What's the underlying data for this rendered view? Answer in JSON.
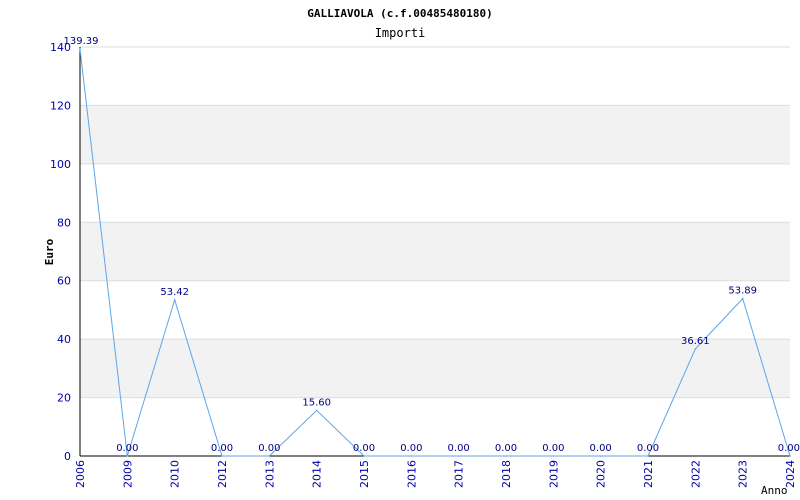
{
  "chart_data": {
    "type": "line",
    "title": "GALLIAVOLA (c.f.00485480180)",
    "subtitle": "Importi",
    "xlabel": "Anno",
    "ylabel": "Euro",
    "categories": [
      "2006",
      "2009",
      "2010",
      "2012",
      "2013",
      "2014",
      "2015",
      "2016",
      "2017",
      "2018",
      "2019",
      "2020",
      "2021",
      "2022",
      "2023",
      "2024"
    ],
    "values": [
      139.39,
      0.0,
      53.42,
      0.0,
      0.0,
      15.6,
      0.0,
      0.0,
      0.0,
      0.0,
      0.0,
      0.0,
      0.0,
      36.61,
      53.89,
      0.0
    ],
    "value_labels": [
      "139.39",
      "0.00",
      "53.42",
      "0.00",
      "0.00",
      "15.60",
      "0.00",
      "0.00",
      "0.00",
      "0.00",
      "0.00",
      "0.00",
      "0.00",
      "36.61",
      "53.89",
      "0.00"
    ],
    "ylim": [
      0,
      140
    ],
    "yticks": [
      "0",
      "20",
      "40",
      "60",
      "80",
      "100",
      "120",
      "140"
    ],
    "grid": true,
    "colors": {
      "line": "#5da5e8",
      "band": "#f2f2f2",
      "grid": "#dddddd",
      "axis": "#000000",
      "tick_text": "#0000aa",
      "data_label": "#000080"
    }
  }
}
